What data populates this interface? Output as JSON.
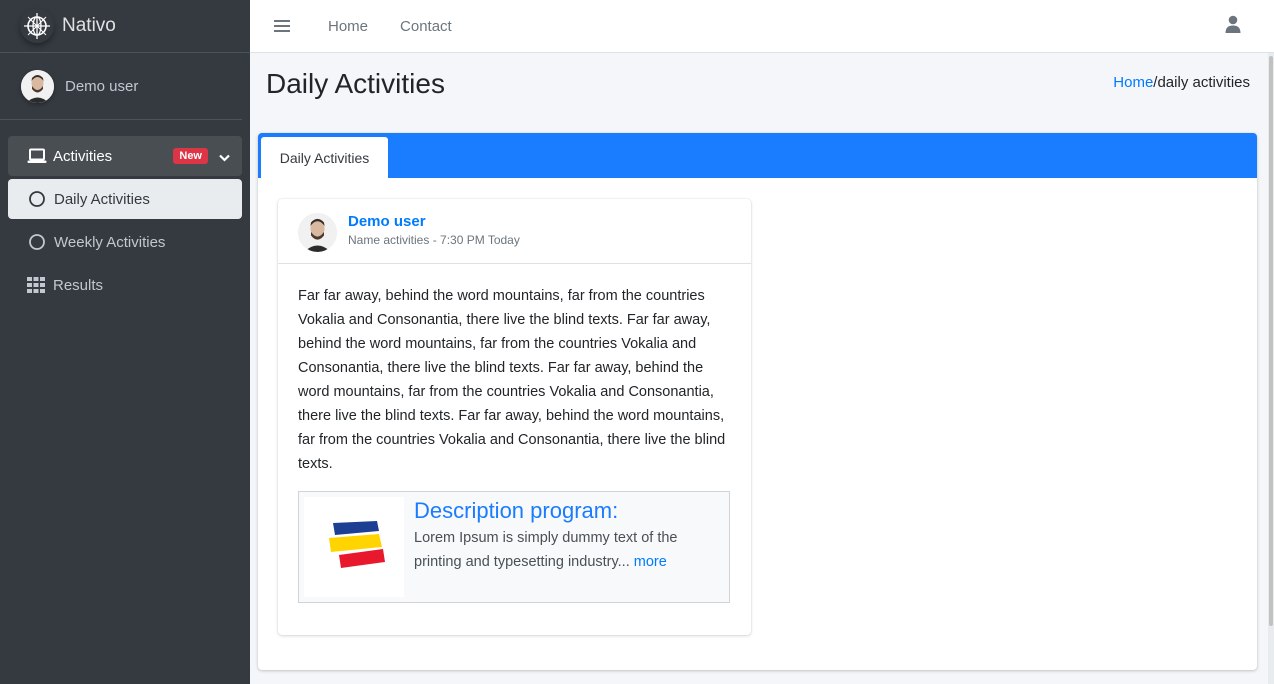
{
  "brand": {
    "name": "Nativo",
    "icon": "globe-logo-icon"
  },
  "sidebar": {
    "user_name": "Demo user",
    "items": [
      {
        "label": "Activities",
        "icon": "laptop-icon",
        "badge": "New",
        "expanded": true
      },
      {
        "label": "Daily Activities",
        "icon": "circle-icon",
        "active": true
      },
      {
        "label": "Weekly Activities",
        "icon": "circle-icon"
      },
      {
        "label": "Results",
        "icon": "grid-icon"
      }
    ]
  },
  "topbar": {
    "menu_icon": "hamburger-icon",
    "links": [
      "Home",
      "Contact"
    ],
    "user_icon": "user-icon"
  },
  "header": {
    "title": "Daily Activities",
    "breadcrumb_home": "Home",
    "breadcrumb_current": "/daily activities"
  },
  "tabs": [
    {
      "label": "Daily Activities",
      "active": true
    }
  ],
  "post": {
    "user": "Demo user",
    "meta": "Name activities - 7:30 PM Today",
    "body": "Far far away, behind the word mountains, far from the countries Vokalia and Consonantia, there live the blind texts. Far far away, behind the word mountains, far from the countries Vokalia and Consonantia, there live the blind texts. Far far away, behind the word mountains, far from the countries Vokalia and Consonantia, there live the blind texts. Far far away, behind the word mountains, far from the countries Vokalia and Consonantia, there live the blind texts.",
    "attachment": {
      "title": "Description program:",
      "text": "Lorem Ipsum is simply dummy text of the printing and typesetting industry...",
      "more": "more"
    }
  },
  "colors": {
    "sidebar_bg": "#343a40",
    "accent": "#1a7cff",
    "link": "#007bff",
    "badge": "#dc3545"
  }
}
